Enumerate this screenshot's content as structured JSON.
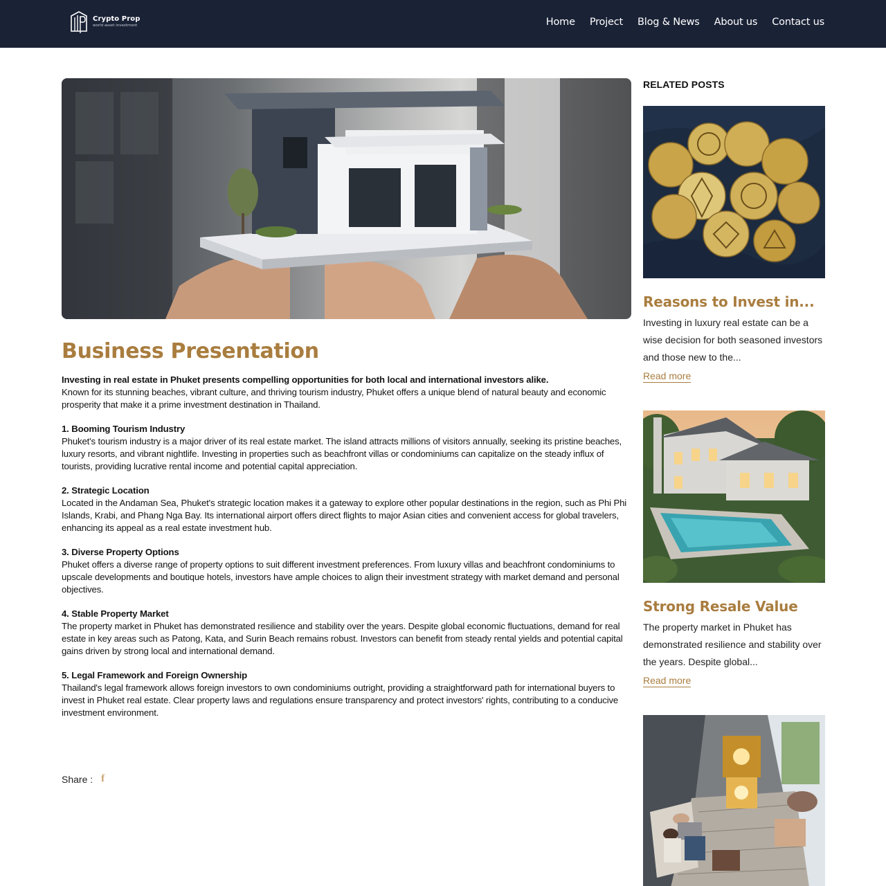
{
  "brand": {
    "name": "Crypto Prop",
    "tagline": "world asset investment"
  },
  "nav": [
    "Home",
    "Project",
    "Blog & News",
    "About us",
    "Contact us"
  ],
  "hero": {
    "icon": "house-model-photo"
  },
  "post": {
    "title": "Business Presentation",
    "lead": "Investing in real estate in Phuket presents compelling opportunities for both local and international investors alike.",
    "intro": "Known for its stunning beaches, vibrant culture, and thriving tourism industry, Phuket offers a unique blend of natural beauty and economic prosperity that make it a prime investment destination in Thailand.",
    "sections": [
      {
        "heading": "1. Booming Tourism Industry",
        "body": "Phuket's tourism industry is a major driver of its real estate market. The island attracts millions of visitors annually, seeking its pristine beaches, luxury resorts, and vibrant nightlife. Investing in properties such as beachfront villas or condominiums can capitalize on the steady influx of tourists, providing lucrative rental income and potential capital appreciation."
      },
      {
        "heading": "2. Strategic Location",
        "body": "Located in the Andaman Sea, Phuket's strategic location makes it a gateway to explore other popular destinations in the region, such as Phi Phi Islands, Krabi, and Phang Nga Bay. Its international airport offers direct flights to major Asian cities and convenient access for global travelers, enhancing its appeal as a real estate investment hub."
      },
      {
        "heading": "3. Diverse Property Options",
        "body": "Phuket offers a diverse range of property options to suit different investment preferences. From luxury villas and beachfront condominiums to upscale developments and boutique hotels, investors have ample choices to align their investment strategy with market demand and personal objectives."
      },
      {
        "heading": "4. Stable Property Market",
        "body": "The property market in Phuket has demonstrated resilience and stability over the years. Despite global economic fluctuations, demand for real estate in key areas such as Patong, Kata, and Surin Beach remains robust. Investors can benefit from steady rental yields and potential capital gains driven by strong local and international demand."
      },
      {
        "heading": "5. Legal Framework and Foreign Ownership",
        "body": "Thailand's legal framework allows foreign investors to own condominiums outright, providing a straightforward path for international buyers to invest in Phuket real estate. Clear property laws and regulations ensure transparency and protect investors' rights, contributing to a conducive investment environment."
      }
    ],
    "share_label": "Share :",
    "share_icon": "facebook-icon"
  },
  "sidebar": {
    "heading": "RELATED POSTS",
    "posts": [
      {
        "title": "Reasons to Invest in...",
        "excerpt": "Investing in luxury real estate can be a wise decision for both seasoned investors and those new to the...",
        "read_more": "Read more",
        "image": "crypto-coins-photo"
      },
      {
        "title": "Strong Resale Value",
        "excerpt": "The property market in Phuket has demonstrated resilience and stability over the years. Despite global...",
        "read_more": "Read more",
        "image": "villa-pool-photo"
      },
      {
        "image": "interior-family-photo"
      }
    ]
  },
  "colors": {
    "header_bg": "#1a2236",
    "accent": "#a97d3f",
    "text": "#141414"
  }
}
